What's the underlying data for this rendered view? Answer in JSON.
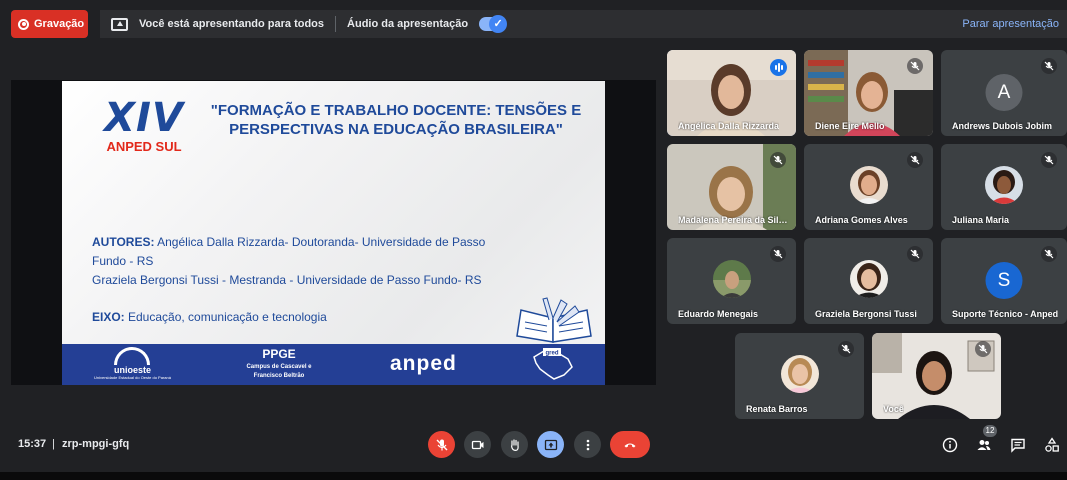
{
  "top": {
    "record_label": "Gravação",
    "presenting_text": "Você está apresentando para todos",
    "audio_label": "Áudio da apresentação",
    "stop_label": "Parar apresentação"
  },
  "slide": {
    "logo_big": "XIV",
    "logo_sub": "ANPED SUL",
    "title": "\"FORMAÇÃO E TRABALHO DOCENTE: TENSÕES E PERSPECTIVAS NA EDUCAÇÃO BRASILEIRA\"",
    "authors_label": "AUTORES:",
    "authors_line1": " Angélica Dalla Rizzarda- Doutoranda- Universidade de Passo Fundo - RS",
    "authors_line2": "Graziela Bergonsi Tussi - Mestranda - Universidade de Passo Fundo- RS",
    "eixo_label": "EIXO:",
    "eixo_value": " Educação, comunicação e tecnologia",
    "footer": {
      "unioeste": "unioeste",
      "unioeste_sub": "Universidade Estadual do Oeste do Paraná",
      "ppge": "PPGE",
      "ppge_sub": "Campus de Cascavel e Francisco Beltrão",
      "anped": "anped",
      "map_tag": "gred"
    }
  },
  "participants": [
    {
      "name": "Angélica Dalla Rizzarda",
      "mic": "speaking"
    },
    {
      "name": "Diene Eire Mello",
      "mic": "muted"
    },
    {
      "name": "Andrews Dubois Jobim",
      "mic": "muted",
      "initial": "A",
      "avatar_color": "#5f6368"
    },
    {
      "name": "Madalena Pereira da Silva",
      "mic": "muted"
    },
    {
      "name": "Adriana Gomes Alves",
      "mic": "muted"
    },
    {
      "name": "Juliana Maria",
      "mic": "muted"
    },
    {
      "name": "Eduardo Menegais",
      "mic": "muted"
    },
    {
      "name": "Graziela Bergonsi Tussi",
      "mic": "muted"
    },
    {
      "name": "Suporte Técnico - Anped",
      "mic": "muted",
      "initial": "S",
      "avatar_color": "#1967d2"
    },
    {
      "name": "Renata Barros",
      "mic": "muted"
    },
    {
      "name": "Você",
      "mic": "muted"
    }
  ],
  "bottom": {
    "time": "15:37",
    "separator": "|",
    "meeting_code": "zrp-mpgi-gfq",
    "people_count": "12"
  },
  "colors": {
    "background": "#202124",
    "tile": "#3c4043",
    "danger": "#ea4335",
    "accent": "#8ab4f8",
    "slide_blue": "#1f4a9a",
    "slide_red": "#e2291b"
  }
}
